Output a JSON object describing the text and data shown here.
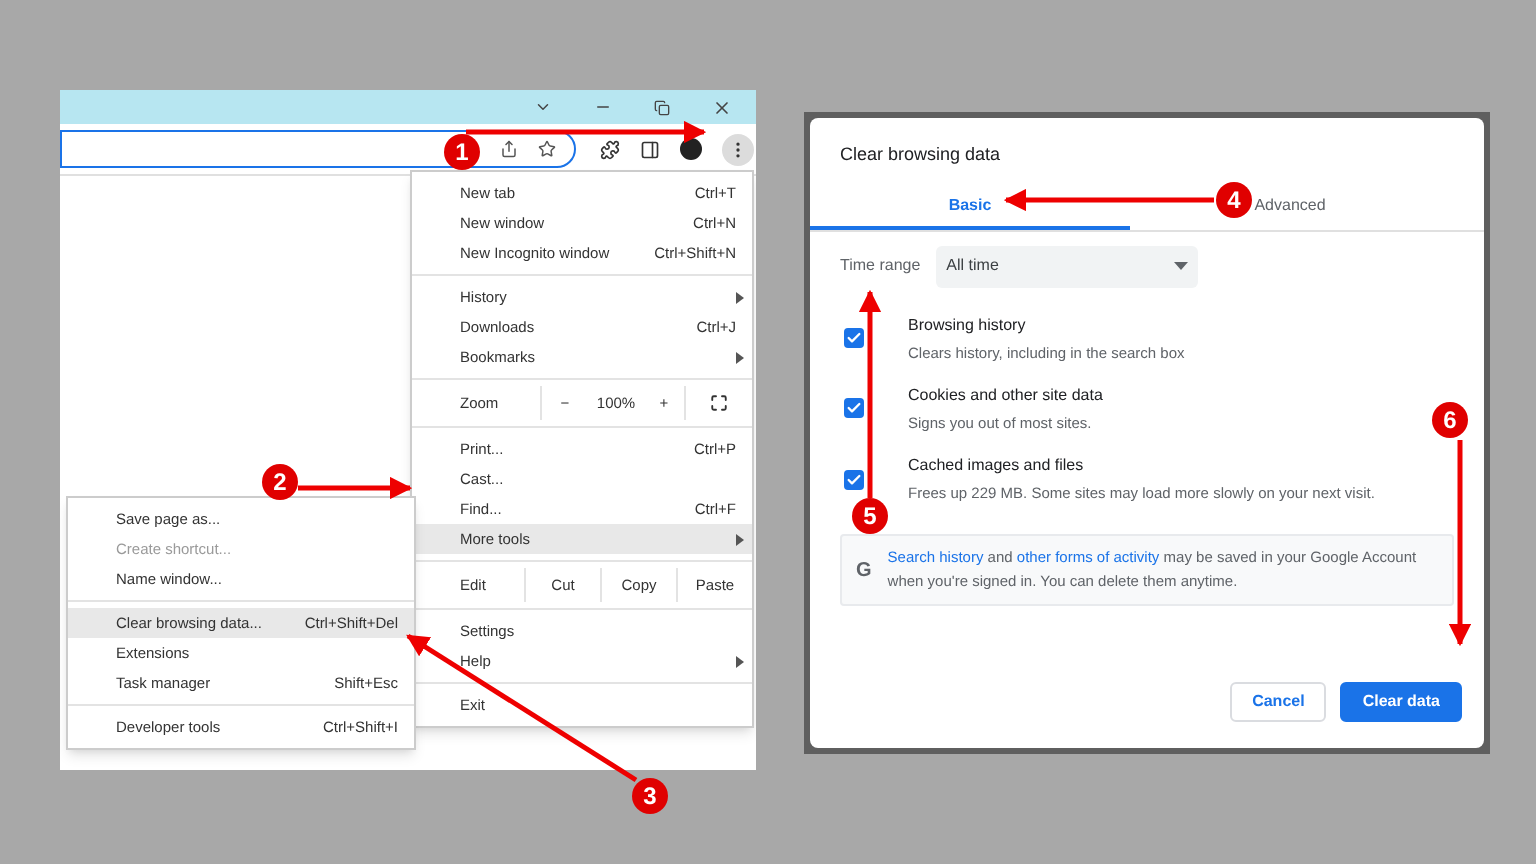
{
  "browser_menu": {
    "items": [
      {
        "kind": "item",
        "label": "New tab",
        "shortcut": "Ctrl+T",
        "submenu": false,
        "highlighted": false
      },
      {
        "kind": "item",
        "label": "New window",
        "shortcut": "Ctrl+N",
        "submenu": false,
        "highlighted": false
      },
      {
        "kind": "item",
        "label": "New Incognito window",
        "shortcut": "Ctrl+Shift+N",
        "submenu": false,
        "highlighted": false
      },
      {
        "kind": "separator"
      },
      {
        "kind": "item",
        "label": "History",
        "submenu": true,
        "highlighted": false
      },
      {
        "kind": "item",
        "label": "Downloads",
        "shortcut": "Ctrl+J",
        "submenu": false,
        "highlighted": false
      },
      {
        "kind": "item",
        "label": "Bookmarks",
        "submenu": true,
        "highlighted": false
      },
      {
        "kind": "separator"
      },
      {
        "kind": "zoom",
        "label": "Zoom",
        "minus": "−",
        "value": "100%",
        "plus": "+"
      },
      {
        "kind": "separator"
      },
      {
        "kind": "item",
        "label": "Print...",
        "shortcut": "Ctrl+P",
        "submenu": false,
        "highlighted": false
      },
      {
        "kind": "item",
        "label": "Cast...",
        "submenu": false,
        "highlighted": false
      },
      {
        "kind": "item",
        "label": "Find...",
        "shortcut": "Ctrl+F",
        "submenu": false,
        "highlighted": false
      },
      {
        "kind": "item",
        "label": "More tools",
        "submenu": true,
        "highlighted": true
      },
      {
        "kind": "separator"
      },
      {
        "kind": "edit",
        "label": "Edit",
        "actions": [
          "Cut",
          "Copy",
          "Paste"
        ]
      },
      {
        "kind": "separator"
      },
      {
        "kind": "item",
        "label": "Settings",
        "submenu": false,
        "highlighted": false
      },
      {
        "kind": "item",
        "label": "Help",
        "submenu": true,
        "highlighted": false
      },
      {
        "kind": "separator"
      },
      {
        "kind": "item",
        "label": "Exit",
        "submenu": false,
        "highlighted": false
      }
    ]
  },
  "more_tools_menu": {
    "items": [
      {
        "kind": "item",
        "label": "Save page as...",
        "disabled": false,
        "highlighted": false
      },
      {
        "kind": "item",
        "label": "Create shortcut...",
        "disabled": true,
        "highlighted": false
      },
      {
        "kind": "item",
        "label": "Name window...",
        "disabled": false,
        "highlighted": false
      },
      {
        "kind": "separator"
      },
      {
        "kind": "item",
        "label": "Clear browsing data...",
        "shortcut": "Ctrl+Shift+Del",
        "disabled": false,
        "highlighted": true
      },
      {
        "kind": "item",
        "label": "Extensions",
        "disabled": false,
        "highlighted": false
      },
      {
        "kind": "item",
        "label": "Task manager",
        "shortcut": "Shift+Esc",
        "disabled": false,
        "highlighted": false
      },
      {
        "kind": "separator"
      },
      {
        "kind": "item",
        "label": "Developer tools",
        "shortcut": "Ctrl+Shift+I",
        "disabled": false,
        "highlighted": false
      }
    ]
  },
  "dialog": {
    "title": "Clear browsing data",
    "tabs": [
      {
        "label": "Basic",
        "selected": true
      },
      {
        "label": "Advanced",
        "selected": false
      }
    ],
    "time_range": {
      "label": "Time range",
      "value": "All time"
    },
    "options": [
      {
        "title": "Browsing history",
        "description": "Clears history, including in the search box",
        "checked": true
      },
      {
        "title": "Cookies and other site data",
        "description": "Signs you out of most sites.",
        "checked": true
      },
      {
        "title": "Cached images and files",
        "description": "Frees up 229 MB. Some sites may load more slowly on your next visit.",
        "checked": true
      }
    ],
    "notice": {
      "logo": "G",
      "parts": [
        {
          "text": "Search history",
          "link": true
        },
        {
          "text": " and ",
          "link": false
        },
        {
          "text": "other forms of activity",
          "link": true
        },
        {
          "text": " may be saved in your Google Account when you're signed in. You can delete them anytime.",
          "link": false
        }
      ]
    },
    "buttons": [
      {
        "label": "Cancel",
        "kind": "secondary"
      },
      {
        "label": "Clear data",
        "kind": "primary"
      }
    ]
  },
  "annotations": [
    {
      "number": "1"
    },
    {
      "number": "2"
    },
    {
      "number": "3"
    },
    {
      "number": "4"
    },
    {
      "number": "5"
    },
    {
      "number": "6"
    }
  ]
}
